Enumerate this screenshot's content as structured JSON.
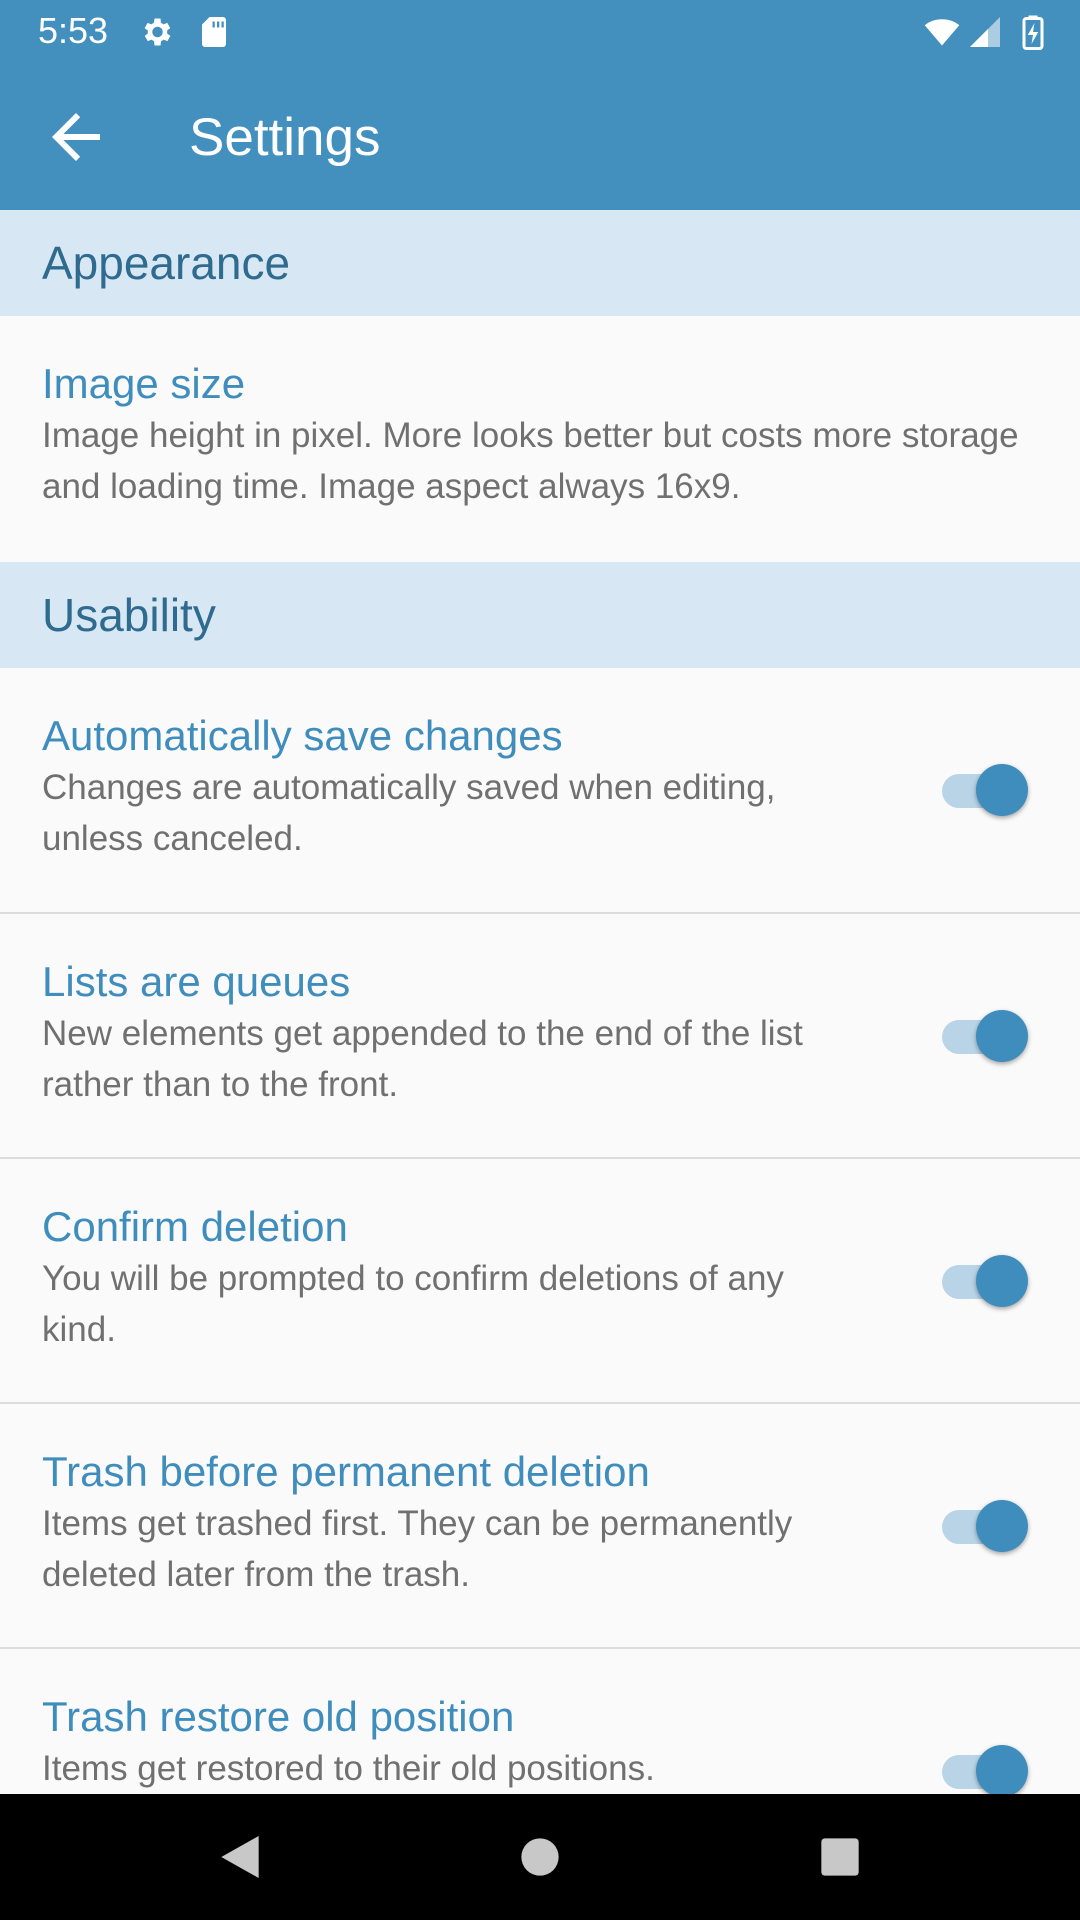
{
  "status_bar": {
    "time": "5:53",
    "left_icons": [
      "gear-icon",
      "sd-card-icon"
    ],
    "right_icons": [
      "wifi-icon",
      "signal-icon",
      "battery-charging-icon"
    ]
  },
  "app_bar": {
    "back_icon": "arrow-back-icon",
    "title": "Settings"
  },
  "colors": {
    "primary": "#4390bf",
    "section_background": "#d7e8f4",
    "pref_title": "#3f8dbd",
    "summary_text": "#707070"
  },
  "sections": [
    {
      "header": "Appearance",
      "items": [
        {
          "title": "Image size",
          "summary": "Image height in pixel. More looks better but costs more storage and loading time. Image aspect always 16x9."
        }
      ]
    },
    {
      "header": "Usability",
      "items": [
        {
          "title": "Automatically save changes",
          "summary": "Changes are automatically saved when editing, unless canceled.",
          "toggle_on": true
        },
        {
          "title": "Lists are queues",
          "summary": "New elements get appended to the end of the list rather than to the front.",
          "toggle_on": true
        },
        {
          "title": "Confirm deletion",
          "summary": "You will be prompted to confirm deletions of any kind.",
          "toggle_on": true
        },
        {
          "title": "Trash before permanent deletion",
          "summary": "Items get trashed first. They can be permanently deleted later from the trash.",
          "toggle_on": true
        },
        {
          "title": "Trash restore old position",
          "summary": "Items get restored to their old positions.",
          "toggle_on": true
        }
      ]
    }
  ],
  "nav_bar": {
    "buttons": [
      "back-triangle-icon",
      "home-circle-icon",
      "recents-square-icon"
    ]
  }
}
